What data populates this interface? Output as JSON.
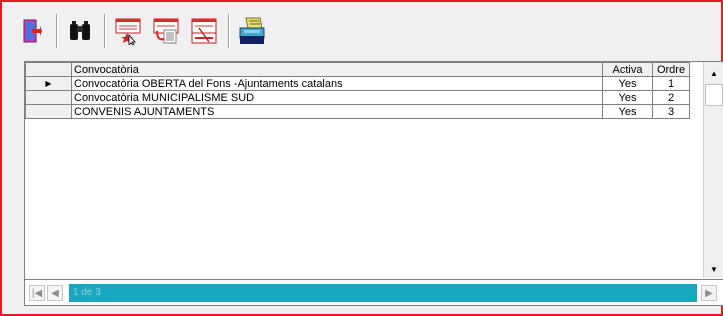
{
  "toolbar": {
    "buttons": [
      {
        "name": "exit-icon"
      },
      {
        "name": "binoculars-search-icon"
      },
      {
        "name": "new-record-icon"
      },
      {
        "name": "copy-record-icon"
      },
      {
        "name": "delete-record-icon"
      },
      {
        "name": "print-icon"
      }
    ]
  },
  "grid": {
    "columns": {
      "convocatoria": "Convocatòria",
      "activa": "Activa",
      "ordre": "Ordre"
    },
    "rows": [
      {
        "selected": true,
        "convocatoria": "Convocatòria OBERTA del Fons -Ajuntaments catalans",
        "activa": "Yes",
        "ordre": "1"
      },
      {
        "selected": false,
        "convocatoria": "Convocatòria MUNICIPALISME SUD",
        "activa": "Yes",
        "ordre": "2"
      },
      {
        "selected": false,
        "convocatoria": "CONVENIS AJUNTAMENTS",
        "activa": "Yes",
        "ordre": "3"
      }
    ]
  },
  "navigator": {
    "record_text": "1 de 3"
  },
  "colors": {
    "frame_border": "#e02020",
    "navigator_bar": "#17a8c0"
  }
}
